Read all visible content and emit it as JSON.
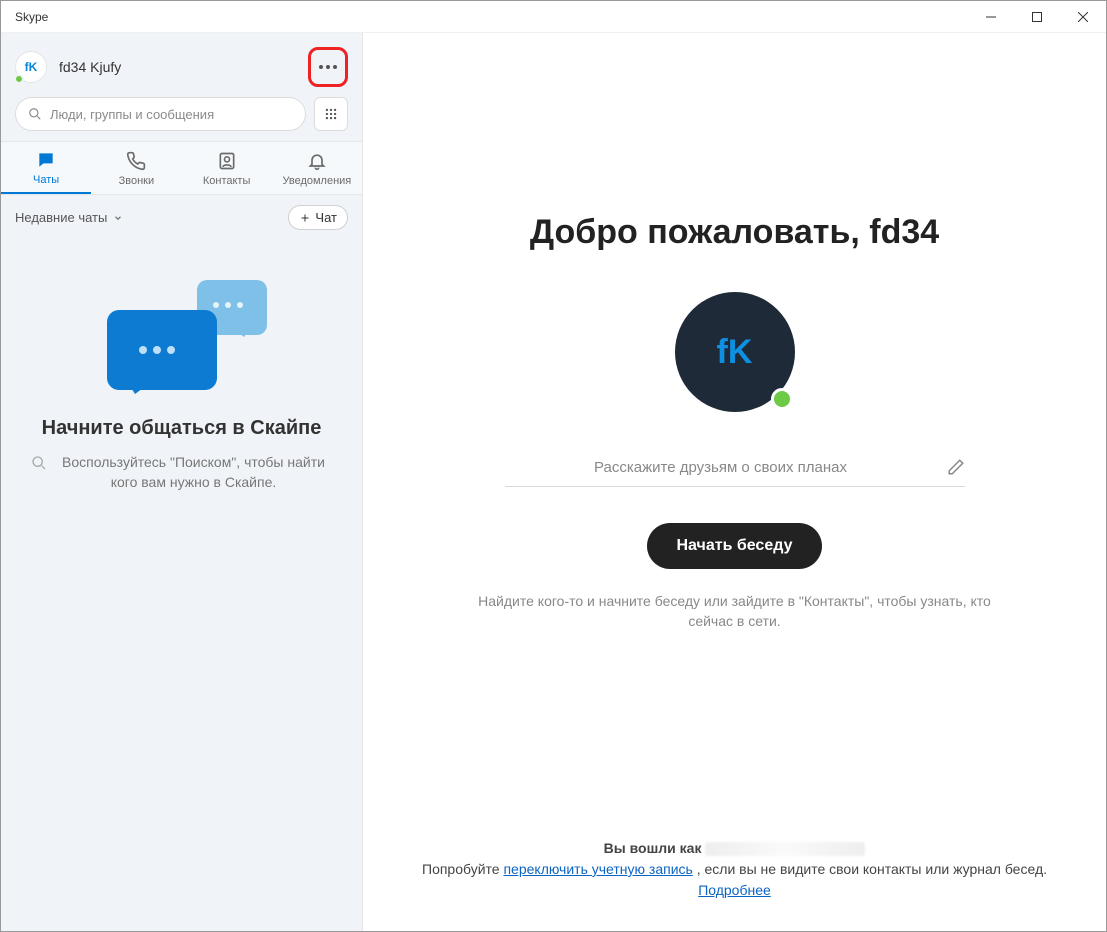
{
  "window": {
    "title": "Skype"
  },
  "profile": {
    "initials": "fK",
    "name": "fd34 Kjufy"
  },
  "search": {
    "placeholder": "Люди, группы и сообщения"
  },
  "tabs": {
    "chats": "Чаты",
    "calls": "Звонки",
    "contacts": "Контакты",
    "notifications": "Уведомления"
  },
  "listbar": {
    "recent": "Недавние чаты",
    "new_chat": "Чат"
  },
  "empty": {
    "title": "Начните общаться в Скайпе",
    "hint": "Воспользуйтесь \"Поиском\", чтобы найти кого вам нужно в Скайпе."
  },
  "welcome": {
    "title": "Добро пожаловать, fd34",
    "avatar_initials": "fK",
    "mood_placeholder": "Расскажите друзьям о своих планах",
    "start_button": "Начать беседу",
    "hint": "Найдите кого-то и начните беседу или зайдите в \"Контакты\", чтобы узнать, кто сейчас в сети."
  },
  "footer": {
    "signed_as_prefix": "Вы вошли как",
    "try_prefix": "Попробуйте ",
    "switch_link": "переключить учетную запись",
    "try_suffix": ", если вы не видите свои контакты или журнал бесед.",
    "more": "Подробнее"
  }
}
